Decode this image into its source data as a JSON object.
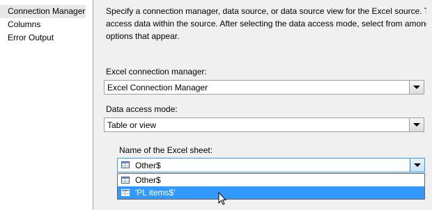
{
  "nav": {
    "items": [
      {
        "label": "Connection Manager",
        "selected": true
      },
      {
        "label": "Columns",
        "selected": false
      },
      {
        "label": "Error Output",
        "selected": false
      }
    ]
  },
  "description": {
    "line1": "Specify a connection manager, data source, or data source view for the Excel source. Then, sele",
    "line2": "access data within the source. After selecting the data access mode, select from among the add",
    "line3": "options that appear."
  },
  "connection_manager": {
    "label": "Excel connection manager:",
    "value": "Excel Connection Manager"
  },
  "access_mode": {
    "label": "Data access mode:",
    "value": "Table or view"
  },
  "sheet": {
    "label": "Name of the Excel sheet:",
    "value": "Other$",
    "options": [
      "Other$",
      "'PL items$'"
    ],
    "highlighted": "'PL items$'"
  },
  "colors": {
    "highlight": "#3399ff",
    "focus_border": "#3399ff"
  }
}
